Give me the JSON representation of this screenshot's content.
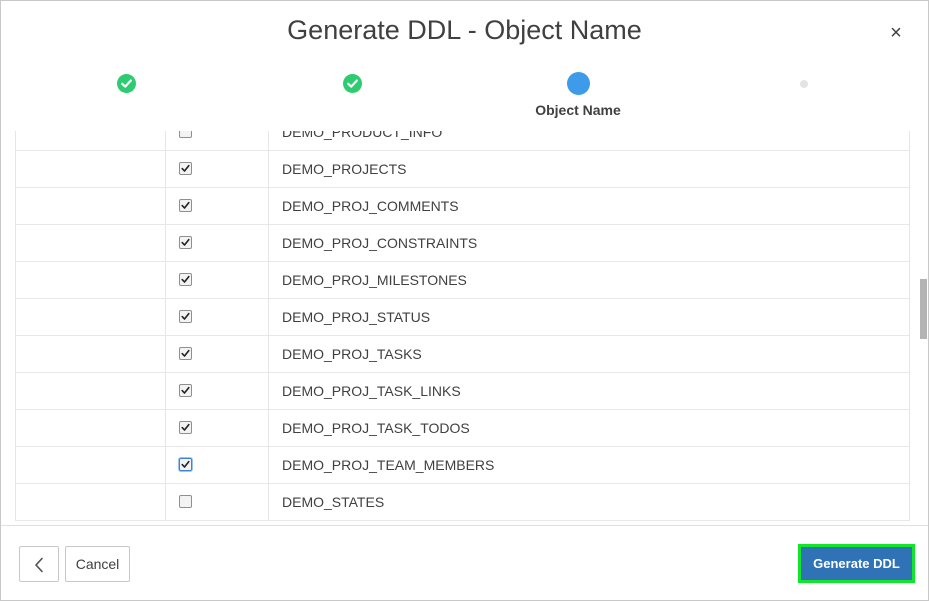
{
  "dialog": {
    "title": "Generate DDL - Object Name",
    "close_symbol": "×"
  },
  "steps": [
    {
      "state": "complete",
      "icon": "check-icon"
    },
    {
      "state": "complete",
      "icon": "check-icon"
    },
    {
      "state": "current",
      "label": "Object Name"
    },
    {
      "state": "future"
    }
  ],
  "objects": [
    {
      "name": "DEMO_PRODUCT_INFO",
      "checked": false
    },
    {
      "name": "DEMO_PROJECTS",
      "checked": true
    },
    {
      "name": "DEMO_PROJ_COMMENTS",
      "checked": true
    },
    {
      "name": "DEMO_PROJ_CONSTRAINTS",
      "checked": true
    },
    {
      "name": "DEMO_PROJ_MILESTONES",
      "checked": true
    },
    {
      "name": "DEMO_PROJ_STATUS",
      "checked": true
    },
    {
      "name": "DEMO_PROJ_TASKS",
      "checked": true
    },
    {
      "name": "DEMO_PROJ_TASK_LINKS",
      "checked": true
    },
    {
      "name": "DEMO_PROJ_TASK_TODOS",
      "checked": true
    },
    {
      "name": "DEMO_PROJ_TEAM_MEMBERS",
      "checked": true,
      "focused": true
    },
    {
      "name": "DEMO_STATES",
      "checked": false
    }
  ],
  "footer": {
    "back_icon": "chevron-left-icon",
    "cancel_label": "Cancel",
    "generate_label": "Generate DDL"
  },
  "colors": {
    "step_complete": "#2ecc71",
    "step_current": "#3d9be9",
    "primary_button": "#2f73b6",
    "highlight_border": "#12e62a"
  }
}
